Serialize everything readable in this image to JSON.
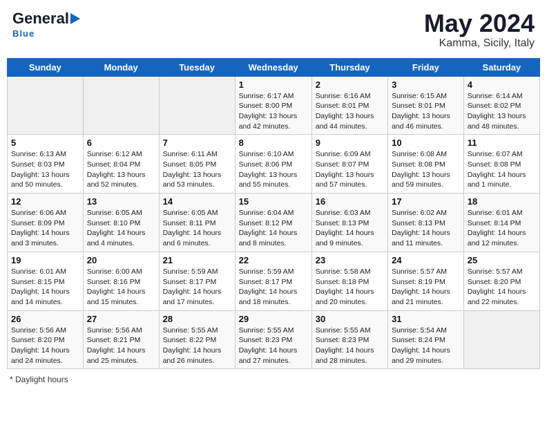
{
  "header": {
    "logo_general": "General",
    "logo_blue": "Blue",
    "month_title": "May 2024",
    "location": "Kamma, Sicily, Italy"
  },
  "days_of_week": [
    "Sunday",
    "Monday",
    "Tuesday",
    "Wednesday",
    "Thursday",
    "Friday",
    "Saturday"
  ],
  "weeks": [
    [
      {
        "day": "",
        "info": ""
      },
      {
        "day": "",
        "info": ""
      },
      {
        "day": "",
        "info": ""
      },
      {
        "day": "1",
        "info": "Sunrise: 6:17 AM\nSunset: 8:00 PM\nDaylight: 13 hours\nand 42 minutes."
      },
      {
        "day": "2",
        "info": "Sunrise: 6:16 AM\nSunset: 8:01 PM\nDaylight: 13 hours\nand 44 minutes."
      },
      {
        "day": "3",
        "info": "Sunrise: 6:15 AM\nSunset: 8:01 PM\nDaylight: 13 hours\nand 46 minutes."
      },
      {
        "day": "4",
        "info": "Sunrise: 6:14 AM\nSunset: 8:02 PM\nDaylight: 13 hours\nand 48 minutes."
      }
    ],
    [
      {
        "day": "5",
        "info": "Sunrise: 6:13 AM\nSunset: 8:03 PM\nDaylight: 13 hours\nand 50 minutes."
      },
      {
        "day": "6",
        "info": "Sunrise: 6:12 AM\nSunset: 8:04 PM\nDaylight: 13 hours\nand 52 minutes."
      },
      {
        "day": "7",
        "info": "Sunrise: 6:11 AM\nSunset: 8:05 PM\nDaylight: 13 hours\nand 53 minutes."
      },
      {
        "day": "8",
        "info": "Sunrise: 6:10 AM\nSunset: 8:06 PM\nDaylight: 13 hours\nand 55 minutes."
      },
      {
        "day": "9",
        "info": "Sunrise: 6:09 AM\nSunset: 8:07 PM\nDaylight: 13 hours\nand 57 minutes."
      },
      {
        "day": "10",
        "info": "Sunrise: 6:08 AM\nSunset: 8:08 PM\nDaylight: 13 hours\nand 59 minutes."
      },
      {
        "day": "11",
        "info": "Sunrise: 6:07 AM\nSunset: 8:08 PM\nDaylight: 14 hours\nand 1 minute."
      }
    ],
    [
      {
        "day": "12",
        "info": "Sunrise: 6:06 AM\nSunset: 8:09 PM\nDaylight: 14 hours\nand 3 minutes."
      },
      {
        "day": "13",
        "info": "Sunrise: 6:05 AM\nSunset: 8:10 PM\nDaylight: 14 hours\nand 4 minutes."
      },
      {
        "day": "14",
        "info": "Sunrise: 6:05 AM\nSunset: 8:11 PM\nDaylight: 14 hours\nand 6 minutes."
      },
      {
        "day": "15",
        "info": "Sunrise: 6:04 AM\nSunset: 8:12 PM\nDaylight: 14 hours\nand 8 minutes."
      },
      {
        "day": "16",
        "info": "Sunrise: 6:03 AM\nSunset: 8:13 PM\nDaylight: 14 hours\nand 9 minutes."
      },
      {
        "day": "17",
        "info": "Sunrise: 6:02 AM\nSunset: 8:13 PM\nDaylight: 14 hours\nand 11 minutes."
      },
      {
        "day": "18",
        "info": "Sunrise: 6:01 AM\nSunset: 8:14 PM\nDaylight: 14 hours\nand 12 minutes."
      }
    ],
    [
      {
        "day": "19",
        "info": "Sunrise: 6:01 AM\nSunset: 8:15 PM\nDaylight: 14 hours\nand 14 minutes."
      },
      {
        "day": "20",
        "info": "Sunrise: 6:00 AM\nSunset: 8:16 PM\nDaylight: 14 hours\nand 15 minutes."
      },
      {
        "day": "21",
        "info": "Sunrise: 5:59 AM\nSunset: 8:17 PM\nDaylight: 14 hours\nand 17 minutes."
      },
      {
        "day": "22",
        "info": "Sunrise: 5:59 AM\nSunset: 8:17 PM\nDaylight: 14 hours\nand 18 minutes."
      },
      {
        "day": "23",
        "info": "Sunrise: 5:58 AM\nSunset: 8:18 PM\nDaylight: 14 hours\nand 20 minutes."
      },
      {
        "day": "24",
        "info": "Sunrise: 5:57 AM\nSunset: 8:19 PM\nDaylight: 14 hours\nand 21 minutes."
      },
      {
        "day": "25",
        "info": "Sunrise: 5:57 AM\nSunset: 8:20 PM\nDaylight: 14 hours\nand 22 minutes."
      }
    ],
    [
      {
        "day": "26",
        "info": "Sunrise: 5:56 AM\nSunset: 8:20 PM\nDaylight: 14 hours\nand 24 minutes."
      },
      {
        "day": "27",
        "info": "Sunrise: 5:56 AM\nSunset: 8:21 PM\nDaylight: 14 hours\nand 25 minutes."
      },
      {
        "day": "28",
        "info": "Sunrise: 5:55 AM\nSunset: 8:22 PM\nDaylight: 14 hours\nand 26 minutes."
      },
      {
        "day": "29",
        "info": "Sunrise: 5:55 AM\nSunset: 8:23 PM\nDaylight: 14 hours\nand 27 minutes."
      },
      {
        "day": "30",
        "info": "Sunrise: 5:55 AM\nSunset: 8:23 PM\nDaylight: 14 hours\nand 28 minutes."
      },
      {
        "day": "31",
        "info": "Sunrise: 5:54 AM\nSunset: 8:24 PM\nDaylight: 14 hours\nand 29 minutes."
      },
      {
        "day": "",
        "info": ""
      }
    ]
  ],
  "footer": {
    "note": "Daylight hours"
  }
}
